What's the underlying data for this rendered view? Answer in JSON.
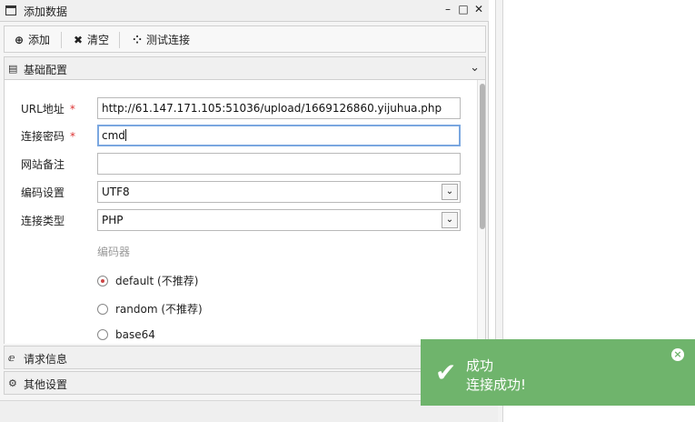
{
  "window": {
    "title": "添加数据",
    "controls": {
      "minimize": "–",
      "maximize": "□",
      "close": "✕"
    }
  },
  "toolbar": {
    "add_label": "添加",
    "clear_label": "清空",
    "test_label": "测试连接"
  },
  "sections": {
    "basic": {
      "label": "基础配置",
      "icon": "document-icon"
    },
    "request": {
      "label": "请求信息",
      "icon": "edge-icon"
    },
    "other": {
      "label": "其他设置",
      "icon": "gears-icon"
    }
  },
  "form": {
    "url": {
      "label": "URL地址",
      "required": "*",
      "value": "http://61.147.171.105:51036/upload/1669126860.yijuhua.php"
    },
    "password": {
      "label": "连接密码",
      "required": "*",
      "value": "cmd"
    },
    "note": {
      "label": "网站备注",
      "value": ""
    },
    "encoding": {
      "label": "编码设置",
      "value": "UTF8"
    },
    "conn_type": {
      "label": "连接类型",
      "value": "PHP"
    },
    "encoder": {
      "title": "编码器",
      "options": [
        {
          "label": "default (不推荐)",
          "selected": true
        },
        {
          "label": "random (不推荐)",
          "selected": false
        },
        {
          "label": "base64",
          "selected": false
        }
      ]
    }
  },
  "toast": {
    "title": "成功",
    "message": "连接成功!",
    "color": "#6fb46c"
  }
}
